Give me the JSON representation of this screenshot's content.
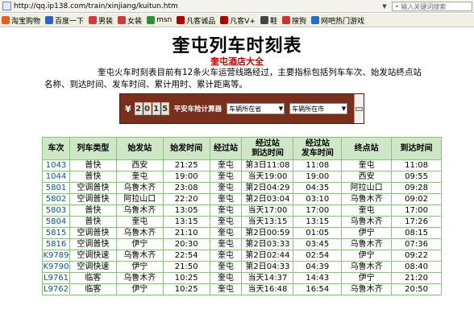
{
  "address_bar": {
    "url": "http://qq.ip138.com/train/xinjiang/kuitun.htm",
    "search_placeholder": "• 输入关键词搜索"
  },
  "favorites": [
    {
      "label": "淘宝购物",
      "color": "#e8601c",
      "icon": "taobao-icon"
    },
    {
      "label": "百度一下",
      "color": "#2a62c8",
      "icon": "baidu-icon"
    },
    {
      "label": "男装",
      "color": "#d23a3a",
      "icon": "tag-icon"
    },
    {
      "label": "女装",
      "color": "#d23a3a",
      "icon": "tag-icon"
    },
    {
      "label": "msn",
      "color": "#2f8f3a",
      "icon": "msn-icon"
    },
    {
      "label": "凡客诚品",
      "color": "#b00000",
      "icon": "vancl-icon"
    },
    {
      "label": "凡客V+",
      "color": "#b00000",
      "icon": "vancl-icon"
    },
    {
      "label": "鞋",
      "color": "#444444",
      "icon": "shoe-icon"
    },
    {
      "label": "搜狗",
      "color": "#cc3333",
      "icon": "sogou-icon"
    },
    {
      "label": "网吧热门游戏",
      "color": "#1f6fc8",
      "icon": "game-icon"
    }
  ],
  "page": {
    "title": "奎屯列车时刻表",
    "subtitle_link": "奎屯酒店大全",
    "intro": "奎屯火车时刻表目前有12条火车运营线路经过，主要指标包括列车车次、始发站终点站名称、到达时间、发车时间、累计用时、累计距离等。"
  },
  "banner": {
    "yen": "¥",
    "digits": [
      "2",
      "0",
      "1",
      "5"
    ],
    "text": "平安车险计算器",
    "select1": "车辆所在省",
    "select2": "车辆所在市"
  },
  "table": {
    "headers": [
      "车次",
      "列车类型",
      "始发站",
      "始发时间",
      "经过站",
      "经过站\n到达时间",
      "经过站\n发车时间",
      "终点站",
      "到达时间"
    ],
    "rows": [
      [
        "1043",
        "普快",
        "西安",
        "21:25",
        "奎屯",
        "第3日11:08",
        "11:08",
        "奎屯",
        "11:08"
      ],
      [
        "1044",
        "普快",
        "奎屯",
        "19:00",
        "奎屯",
        "当天19:00",
        "19:00",
        "西安",
        "09:55"
      ],
      [
        "5801",
        "空调普快",
        "乌鲁木齐",
        "23:08",
        "奎屯",
        "第2日04:29",
        "04:35",
        "阿拉山口",
        "09:28"
      ],
      [
        "5802",
        "空调普快",
        "阿拉山口",
        "22:20",
        "奎屯",
        "第2日03:04",
        "03:10",
        "乌鲁木齐",
        "09:02"
      ],
      [
        "5803",
        "普快",
        "乌鲁木齐",
        "13:05",
        "奎屯",
        "当天17:00",
        "17:00",
        "奎屯",
        "17:00"
      ],
      [
        "5804",
        "普快",
        "奎屯",
        "13:15",
        "奎屯",
        "当天13:15",
        "13:15",
        "乌鲁木齐",
        "17:26"
      ],
      [
        "5815",
        "空调普快",
        "乌鲁木齐",
        "21:10",
        "奎屯",
        "第2日00:59",
        "01:05",
        "伊宁",
        "08:15"
      ],
      [
        "5816",
        "空调普快",
        "伊宁",
        "20:30",
        "奎屯",
        "第2日03:33",
        "03:45",
        "乌鲁木齐",
        "07:36"
      ],
      [
        "K9789",
        "空调快速",
        "乌鲁木齐",
        "22:54",
        "奎屯",
        "第2日02:44",
        "02:54",
        "伊宁",
        "09:22"
      ],
      [
        "K9790",
        "空调快速",
        "伊宁",
        "21:50",
        "奎屯",
        "第2日04:33",
        "04:39",
        "乌鲁木齐",
        "08:40"
      ],
      [
        "L9761",
        "临客",
        "乌鲁木齐",
        "10:25",
        "奎屯",
        "当天14:37",
        "14:43",
        "伊宁",
        "21:20"
      ],
      [
        "L9762",
        "临客",
        "伊宁",
        "10:25",
        "奎屯",
        "当天16:48",
        "16:54",
        "乌鲁木齐",
        "20:50"
      ]
    ]
  }
}
